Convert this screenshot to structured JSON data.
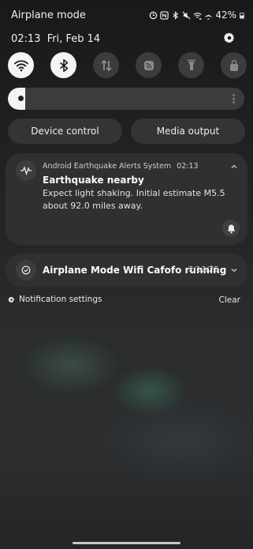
{
  "status_bar": {
    "title": "Airplane mode",
    "battery": "42%",
    "icons": [
      "data-saver-icon",
      "nfc-icon",
      "bluetooth-icon",
      "mute-icon",
      "wifi-icon",
      "airplane-icon",
      "battery-icon"
    ]
  },
  "header": {
    "time": "02:13",
    "date": "Fri, Feb 14"
  },
  "quick_settings": {
    "tiles": [
      {
        "name": "wifi",
        "state": "on"
      },
      {
        "name": "bluetooth",
        "state": "on"
      },
      {
        "name": "mobile-data",
        "state": "off"
      },
      {
        "name": "cast",
        "state": "off"
      },
      {
        "name": "flashlight",
        "state": "off"
      },
      {
        "name": "lock-screen",
        "state": "off"
      }
    ],
    "brightness_level": 0.05
  },
  "buttons": {
    "device_control": "Device control",
    "media_output": "Media output"
  },
  "notifications": [
    {
      "app": "Android Earthquake Alerts System",
      "time": "02:13",
      "title": "Earthquake nearby",
      "body": "Expect light shaking. Initial estimate M5.5 about 92.0 miles away."
    },
    {
      "title": "Airplane Mode Wifi Cafofo running",
      "date": "2/13/25"
    }
  ],
  "footer": {
    "settings": "Notification settings",
    "clear": "Clear"
  },
  "colors": {
    "tile_on": "#f4f4f4",
    "tile_off": "#3a3c3e",
    "card": "#2e3032"
  }
}
